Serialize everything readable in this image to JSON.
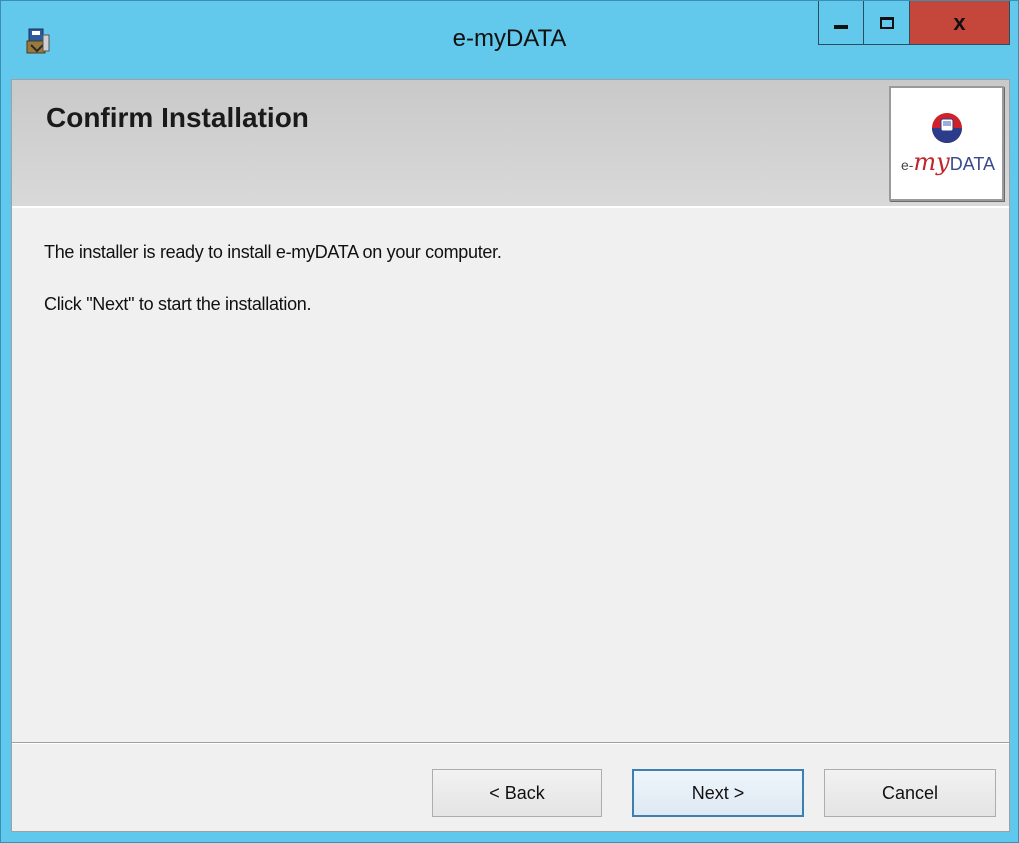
{
  "window": {
    "title": "e-myDATA",
    "controls": {
      "minimize_icon": "minimize-icon",
      "maximize_icon": "maximize-icon",
      "close_glyph": "x"
    },
    "colors": {
      "titlebar": "#62c9ec",
      "close_button": "#c5473b"
    }
  },
  "banner": {
    "title": "Confirm Installation",
    "logo": {
      "prefix": "e-",
      "my": "my",
      "data": "DATA"
    }
  },
  "body": {
    "line1": "The installer is ready to install e-myDATA on your computer.",
    "line2": "Click \"Next\" to start the installation."
  },
  "buttons": {
    "back": "< Back",
    "next": "Next >",
    "cancel": "Cancel"
  }
}
